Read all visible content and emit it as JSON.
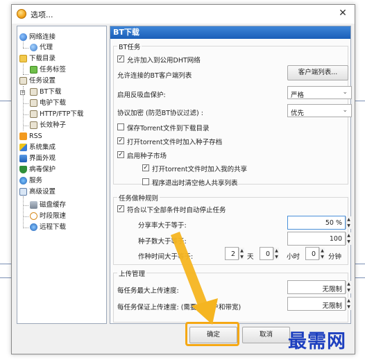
{
  "window": {
    "title": "选项...",
    "close_glyph": "✕"
  },
  "tree": {
    "items": [
      {
        "label": "网络连接"
      },
      {
        "label": "代理"
      },
      {
        "label": "下载目录"
      },
      {
        "label": "任务标签"
      },
      {
        "label": "任务设置"
      },
      {
        "label": "BT下载"
      },
      {
        "label": "电驴下载"
      },
      {
        "label": "HTTP/FTP下载"
      },
      {
        "label": "长效种子"
      },
      {
        "label": "RSS"
      },
      {
        "label": "系统集成"
      },
      {
        "label": "界面外观"
      },
      {
        "label": "病毒保护"
      },
      {
        "label": "服务"
      },
      {
        "label": "高级设置"
      },
      {
        "label": "磁盘缓存"
      },
      {
        "label": "时段限速"
      },
      {
        "label": "远程下载"
      }
    ]
  },
  "panel": {
    "header": "BT下载",
    "bt_task": {
      "group_label": "BT任务",
      "allow_dht": "允许加入到公用DHT网络",
      "allowed_clients": "允许连接的BT客户端列表",
      "client_list_button": "客户端列表...",
      "leech_protection_label": "启用反吸血保护:",
      "leech_protection_value": "严格",
      "encryption_label": "协议加密 (防范BT协议过滤) :",
      "encryption_value": "优先",
      "save_torrent": "保存Torrent文件到下载目录",
      "open_torrent_seed": "打开torrent文件时加入种子存档",
      "seed_market": "启用种子市场",
      "share_on_open": "打开torrent文件时加入我的共享",
      "clear_on_exit": "程序退出时清空他人共享列表"
    },
    "seeding": {
      "group_label": "任务做种规则",
      "auto_stop": "符合以下全部条件时自动停止任务",
      "ratio_label": "分享率大于等于:",
      "ratio_value": "50 %",
      "seeds_label": "种子数大于等于:",
      "seeds_value": "100",
      "time_label": "作种时间大于等于:",
      "days_value": "2",
      "days_unit": "天",
      "hours_value": "0",
      "hours_unit": "小时",
      "minutes_value": "0",
      "minutes_unit": "分钟"
    },
    "upload": {
      "group_label": "上传管理",
      "max_label": "每任务最大上传速度:",
      "max_value": "无限制",
      "guarantee_label": "每任务保证上传速度: (需要         的用户和带宽)",
      "guarantee_value": "无限制"
    }
  },
  "footer": {
    "ok": "确定",
    "cancel": "取消"
  },
  "watermark": "最需网",
  "colors": {
    "header": "#1f64bf",
    "highlight": "#f5a814",
    "arrow": "#f5b521",
    "watermark": "#1d3fbf"
  }
}
